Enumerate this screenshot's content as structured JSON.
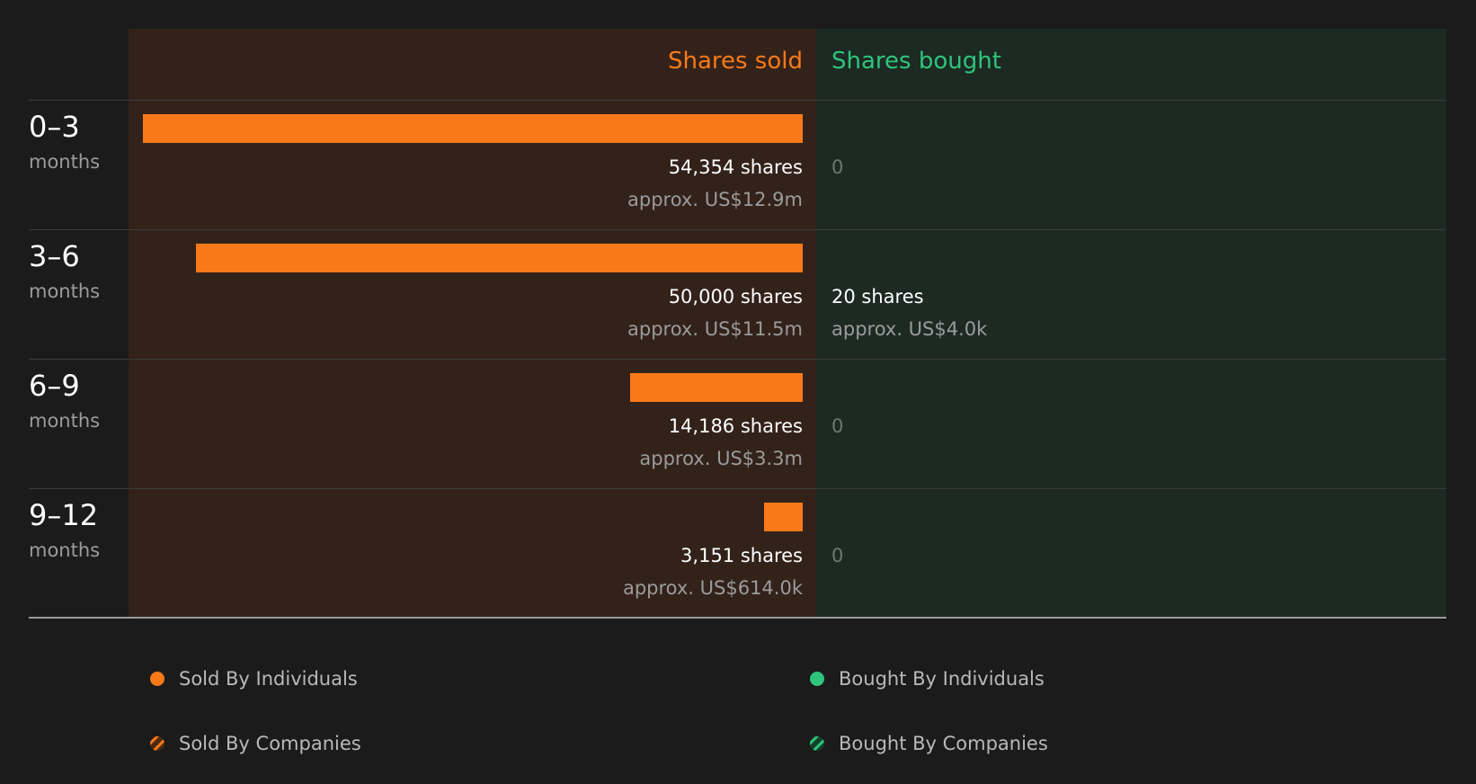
{
  "colors": {
    "sold": "#f97919",
    "bought": "#2fc47b"
  },
  "header": {
    "sold_label": "Shares sold",
    "bought_label": "Shares bought"
  },
  "chart_data": {
    "type": "bar",
    "categories": [
      "0–3",
      "3–6",
      "6–9",
      "9–12"
    ],
    "category_unit": "months",
    "series": [
      {
        "name": "Shares sold",
        "values": [
          54354,
          50000,
          14186,
          3151
        ]
      },
      {
        "name": "Shares bought",
        "values": [
          0,
          20,
          0,
          0
        ]
      }
    ]
  },
  "rows": [
    {
      "period": "0–3",
      "unit": "months",
      "sold_value": 54354,
      "sold_shares": "54,354 shares",
      "sold_approx": "approx. US$12.9m",
      "bought_value": 0,
      "bought_shares": "0",
      "bought_approx": ""
    },
    {
      "period": "3–6",
      "unit": "months",
      "sold_value": 50000,
      "sold_shares": "50,000 shares",
      "sold_approx": "approx. US$11.5m",
      "bought_value": 20,
      "bought_shares": "20 shares",
      "bought_approx": "approx. US$4.0k"
    },
    {
      "period": "6–9",
      "unit": "months",
      "sold_value": 14186,
      "sold_shares": "14,186 shares",
      "sold_approx": "approx. US$3.3m",
      "bought_value": 0,
      "bought_shares": "0",
      "bought_approx": ""
    },
    {
      "period": "9–12",
      "unit": "months",
      "sold_value": 3151,
      "sold_shares": "3,151 shares",
      "sold_approx": "approx. US$614.0k",
      "bought_value": 0,
      "bought_shares": "0",
      "bought_approx": ""
    }
  ],
  "legend": {
    "sold_individuals": "Sold By Individuals",
    "sold_companies": "Sold By Companies",
    "bought_individuals": "Bought By Individuals",
    "bought_companies": "Bought By Companies"
  }
}
